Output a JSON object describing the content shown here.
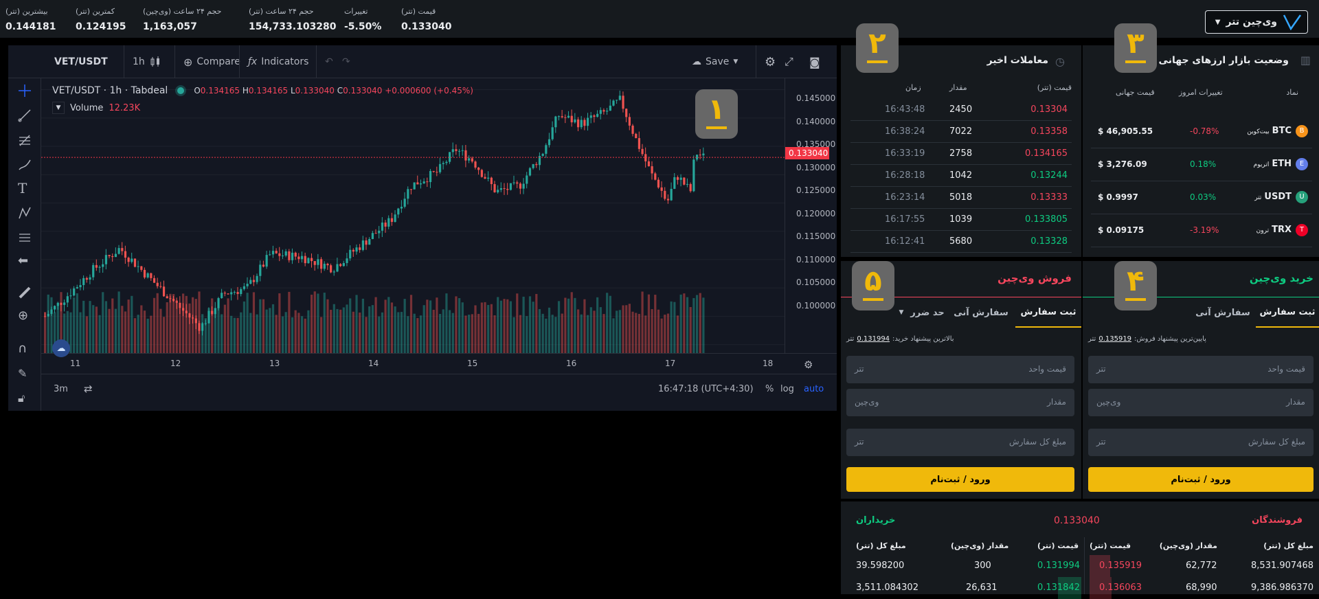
{
  "header": {
    "stats": [
      {
        "label": "قیمت (تتر)",
        "value": "0.133040"
      },
      {
        "label": "تغییرات",
        "value": "-5.50%"
      },
      {
        "label": "حجم ۲۴ ساعت (تتر)",
        "value": "154,733.103280"
      },
      {
        "label": "حجم ۲۴ ساعت (وی‌چین)",
        "value": "1,163,057"
      },
      {
        "label": "کمترین (تتر)",
        "value": "0.124195"
      },
      {
        "label": "بیشترین (تتر)",
        "value": "0.144181"
      }
    ],
    "pair_label": "وی‌چین تتر",
    "colors": {
      "accent": "#f0b90b",
      "up": "#0ecb81",
      "down": "#f6465d"
    }
  },
  "chart": {
    "symbol": "VET/USDT",
    "interval": "1h",
    "compare": "Compare",
    "indicators": "Indicators",
    "save": "Save",
    "legend_title": "VET/USDT · 1h · Tabdeal",
    "ohlc": {
      "o_label": "O",
      "o": "0.134165",
      "h_label": "H",
      "h": "0.134165",
      "l_label": "L",
      "l": "0.133040",
      "c_label": "C",
      "c": "0.133040",
      "change": "+0.000600 (+0.45%)"
    },
    "volume_label": "Volume",
    "volume_value": "12.23K",
    "last_price_tag": "0.133040",
    "price_ticks": [
      "0.145000",
      "0.140000",
      "0.135000",
      "0.130000",
      "0.125000",
      "0.120000",
      "0.115000",
      "0.110000",
      "0.105000",
      "0.100000"
    ],
    "time_ticks": [
      "11",
      "12",
      "13",
      "14",
      "15",
      "16",
      "17",
      "18"
    ],
    "range_btn": "3m",
    "clock": "16:47:18 (UTC+4:30)",
    "scale_pct": "%",
    "scale_log": "log",
    "scale_auto": "auto",
    "badge": "۱"
  },
  "recent_trades": {
    "title": "معاملات اخیر",
    "badge": "۲",
    "headers": {
      "price": "قیمت (تتر)",
      "amount": "مقدار",
      "time": "زمان"
    },
    "rows": [
      {
        "price": "0.13304",
        "amount": "2450",
        "time": "16:43:48",
        "side": "sell"
      },
      {
        "price": "0.13358",
        "amount": "7022",
        "time": "16:38:24",
        "side": "sell"
      },
      {
        "price": "0.134165",
        "amount": "2758",
        "time": "16:33:19",
        "side": "sell"
      },
      {
        "price": "0.13244",
        "amount": "1042",
        "time": "16:28:18",
        "side": "buy"
      },
      {
        "price": "0.13333",
        "amount": "5018",
        "time": "16:23:14",
        "side": "sell"
      },
      {
        "price": "0.133805",
        "amount": "1039",
        "time": "16:17:55",
        "side": "buy"
      },
      {
        "price": "0.13328",
        "amount": "5680",
        "time": "16:12:41",
        "side": "buy"
      }
    ]
  },
  "global_market": {
    "title": "وضعیت بازار ارزهای جهانی",
    "badge": "۳",
    "headers": {
      "symbol": "نماد",
      "change": "تغییرات امروز",
      "price": "قیمت جهانی"
    },
    "rows": [
      {
        "symbol": "BTC",
        "name": "بیت‌کوین",
        "change": "-0.78%",
        "price": "$ 46,905.55",
        "dir": "down",
        "icon_color": "#f7931a"
      },
      {
        "symbol": "ETH",
        "name": "اتریوم",
        "change": "0.18%",
        "price": "$ 3,276.09",
        "dir": "up",
        "icon_color": "#627eea"
      },
      {
        "symbol": "USDT",
        "name": "تتر",
        "change": "0.03%",
        "price": "$ 0.9997",
        "dir": "up",
        "icon_color": "#26a17b"
      },
      {
        "symbol": "TRX",
        "name": "ترون",
        "change": "-3.19%",
        "price": "$ 0.09175",
        "dir": "down",
        "icon_color": "#ef0027"
      }
    ]
  },
  "buy": {
    "title": "خرید وی‌چین",
    "badge": "۴",
    "tabs": [
      "ثبت سفارش",
      "سفارش آنی"
    ],
    "best_label": "پایین‌ترین پیشنهاد فروش:",
    "best_value": "0.135919",
    "best_unit": "تتر",
    "fields": [
      {
        "label": "قیمت واحد",
        "unit": "تتر"
      },
      {
        "label": "مقدار",
        "unit": "وی‌چین"
      },
      {
        "label": "مبلغ کل سفارش",
        "unit": "تتر"
      }
    ],
    "button": "ورود / ثبت‌نام"
  },
  "sell": {
    "title": "فروش وی‌چین",
    "badge": "۵",
    "tabs": [
      "ثبت سفارش",
      "سفارش آنی",
      "حد ضرر"
    ],
    "best_label": "بالاترین پیشنهاد خرید:",
    "best_value": "0.131994",
    "best_unit": "تتر",
    "fields": [
      {
        "label": "قیمت واحد",
        "unit": "تتر"
      },
      {
        "label": "مقدار",
        "unit": "وی‌چین"
      },
      {
        "label": "مبلغ کل سفارش",
        "unit": "تتر"
      }
    ],
    "button": "ورود / ثبت‌نام"
  },
  "orderbook": {
    "sellers_title": "فروشندگان",
    "buyers_title": "خریداران",
    "mid_price": "0.133040",
    "headers": {
      "price": "قیمت (تتر)",
      "amount": "مقدار (وی‌چین)",
      "total": "مبلغ کل (تتر)"
    },
    "sellers": [
      {
        "price": "0.135919",
        "amount": "62,772",
        "total": "8,531.907468"
      },
      {
        "price": "0.136063",
        "amount": "68,990",
        "total": "9,386.986370"
      }
    ],
    "buyers": [
      {
        "price": "0.131994",
        "amount": "300",
        "total": "39.598200"
      },
      {
        "price": "0.131842",
        "amount": "26,631",
        "total": "3,511.084302"
      }
    ]
  }
}
